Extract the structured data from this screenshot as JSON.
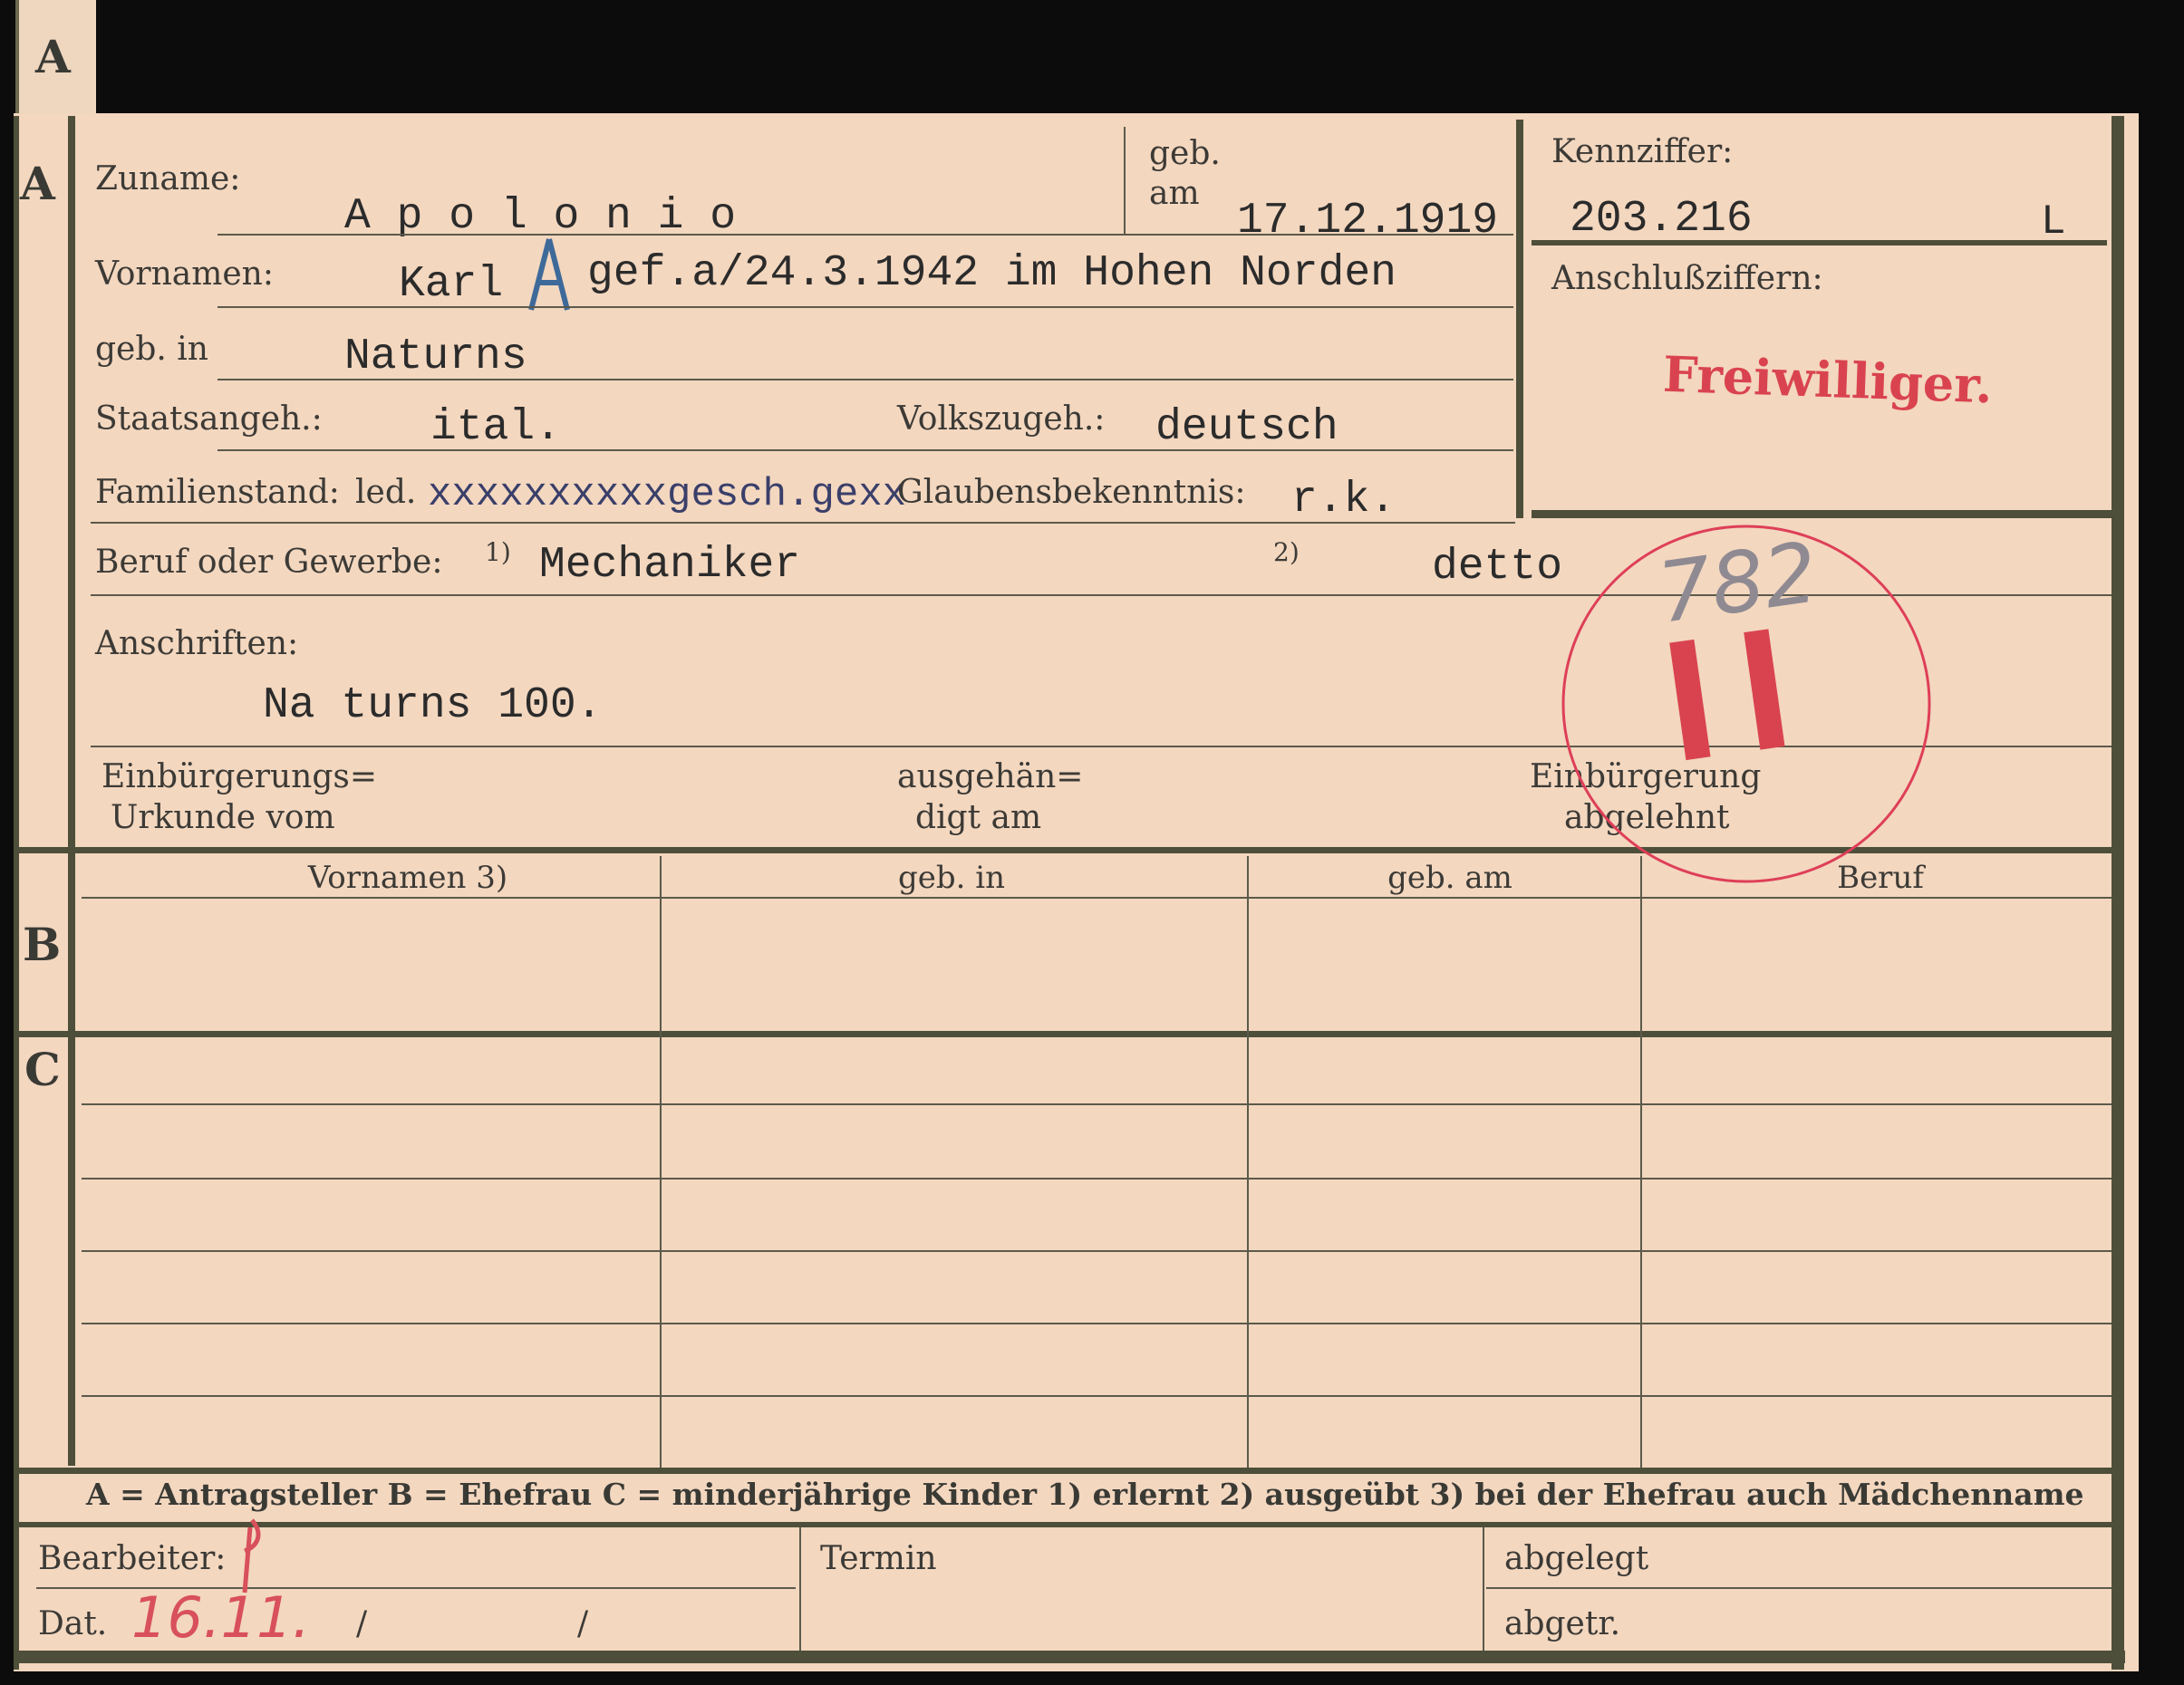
{
  "section_letters": {
    "a_tab": "A",
    "a": "A",
    "b": "B",
    "c": "C"
  },
  "header": {
    "zuname_label": "Zuname:",
    "zuname_value": "A p o l o n i o",
    "geb_label_1": "geb.",
    "geb_label_2": "am",
    "geb_am_value": "17.12.1919",
    "kennziffer_label": "Kennziffer:",
    "kennziffer_value": "203.216",
    "kennziffer_suffix": "L",
    "anschluss_label": "Anschlußziffern:",
    "freiwilliger_stamp": "Freiwilliger."
  },
  "fields": {
    "vornamen_label": "Vornamen:",
    "vornamen_value": "Karl",
    "vornamen_note": "gef.a/24.3.1942 im Hohen Norden",
    "geb_in_label": "geb. in",
    "geb_in_value": "Naturns",
    "staatsangeh_label": "Staatsangeh.:",
    "staatsangeh_value": "ital.",
    "volkszugeh_label": "Volkszugeh.:",
    "volkszugeh_value": "deutsch",
    "familienstand_label": "Familienstand:",
    "familienstand_printed": "led.",
    "familienstand_value": "xxxxxxxxxxgesch.gexx",
    "glaubens_label": "Glaubensbekenntnis:",
    "glaubens_value": "r.k.",
    "beruf_label": "Beruf oder Gewerbe:",
    "beruf_mark1": "1)",
    "beruf_value1": "Mechaniker",
    "beruf_mark2": "2)",
    "beruf_value2": "detto",
    "anschriften_label": "Anschriften:",
    "anschriften_value": "Na turns 100.",
    "einb_label_1": "Einbürgerungs=",
    "einb_label_2": "Urkunde vom",
    "ausg_label_1": "ausgehän=",
    "ausg_label_2": "digt am",
    "abgelehnt_label_1": "Einbürgerung",
    "abgelehnt_label_2": "abgelehnt"
  },
  "round_stamp": {
    "number": "782",
    "mark": "II"
  },
  "table": {
    "columns": [
      "Vornamen 3)",
      "geb. in",
      "geb. am",
      "Beruf"
    ]
  },
  "legend": "A = Antragsteller   B = Ehefrau   C = minderjährige Kinder   1) erlernt   2) ausgeübt   3) bei der Ehefrau auch Mädchenname",
  "footer": {
    "bearbeiter_label": "Bearbeiter:",
    "dat_label": "Dat.",
    "dat_value": "16.11.",
    "slash1": "/",
    "slash2": "/",
    "termin_label": "Termin",
    "abgelegt_label": "abgelegt",
    "abgetr_label": "abgetr."
  },
  "colors": {
    "card": "#f3d7bf",
    "frame": "#4d4f3a",
    "stamp_red": "#d9434f",
    "ink": "#2b2b2b"
  }
}
